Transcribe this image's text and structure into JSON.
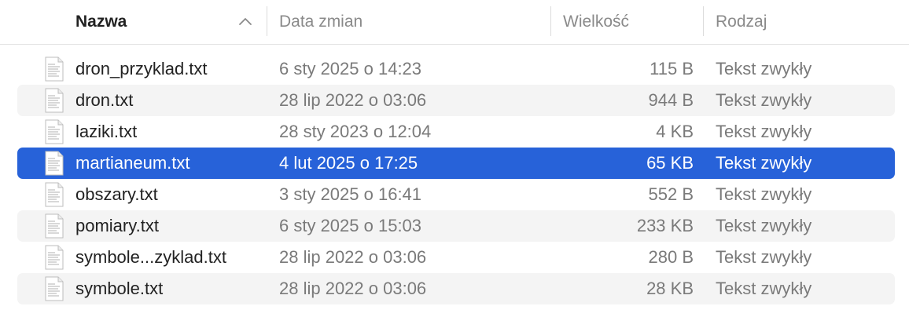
{
  "columns": {
    "name": "Nazwa",
    "date": "Data zmian",
    "size": "Wielkość",
    "kind": "Rodzaj",
    "sort_icon": "chevron-up-icon"
  },
  "files": [
    {
      "name": "dron_przyklad.txt",
      "date": "6 sty 2025 o 14:23",
      "size": "115 B",
      "kind": "Tekst zwykły",
      "icon": "text-file-icon"
    },
    {
      "name": "dron.txt",
      "date": "28 lip 2022 o 03:06",
      "size": "944 B",
      "kind": "Tekst zwykły",
      "icon": "text-file-icon"
    },
    {
      "name": "laziki.txt",
      "date": "28 sty 2023 o 12:04",
      "size": "4 KB",
      "kind": "Tekst zwykły",
      "icon": "text-file-icon"
    },
    {
      "name": "martianeum.txt",
      "date": "4 lut 2025 o 17:25",
      "size": "65 KB",
      "kind": "Tekst zwykły",
      "icon": "text-file-icon",
      "selected": true
    },
    {
      "name": "obszary.txt",
      "date": "3 sty 2025 o 16:41",
      "size": "552 B",
      "kind": "Tekst zwykły",
      "icon": "text-file-icon"
    },
    {
      "name": "pomiary.txt",
      "date": "6 sty 2025 o 15:03",
      "size": "233 KB",
      "kind": "Tekst zwykły",
      "icon": "text-file-icon"
    },
    {
      "name": "symbole...zyklad.txt",
      "date": "28 lip 2022 o 03:06",
      "size": "280 B",
      "kind": "Tekst zwykły",
      "icon": "text-file-icon"
    },
    {
      "name": "symbole.txt",
      "date": "28 lip 2022 o 03:06",
      "size": "28 KB",
      "kind": "Tekst zwykły",
      "icon": "text-file-icon"
    }
  ],
  "colors": {
    "selection": "#2762d9",
    "alternate_row": "#f4f4f4"
  }
}
